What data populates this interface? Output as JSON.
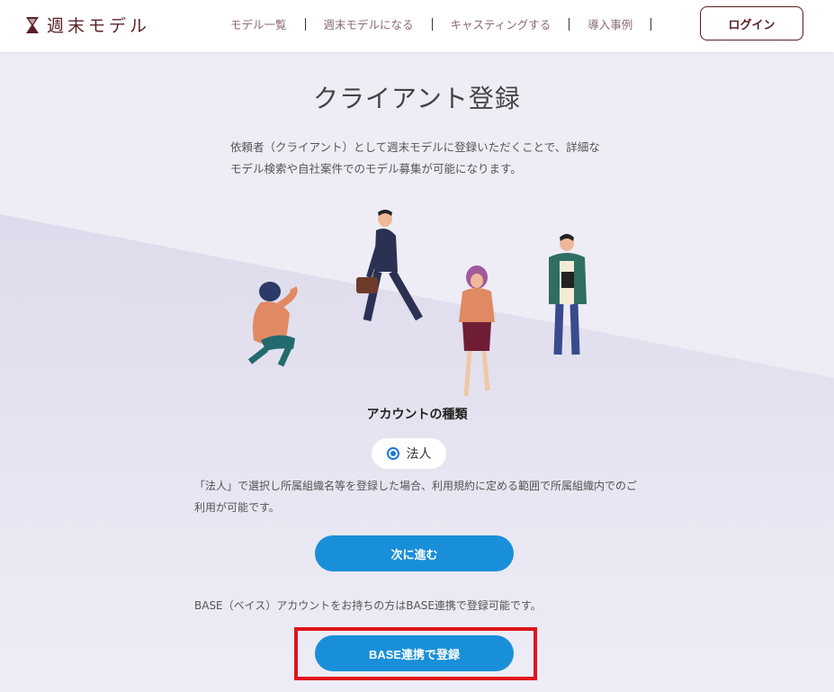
{
  "header": {
    "logo_text": "週末モデル",
    "nav": [
      "モデル一覧",
      "週末モデルになる",
      "キャスティングする",
      "導入事例"
    ],
    "login_label": "ログイン"
  },
  "main": {
    "title": "クライアント登録",
    "intro": "依頼者（クライアント）として週末モデルに登録いただくことで、詳細なモデル検索や自社案件でのモデル募集が可能になります。",
    "account_type_label": "アカウントの種類",
    "account_type_option": "法人",
    "corporate_note": "「法人」で選択し所属組織名等を登録した場合、利用規約に定める範囲で所属組織内でのご利用が可能です。",
    "next_button": "次に進む",
    "base_note": "BASE（ベイス）アカウントをお持ちの方はBASE連携で登録可能です。",
    "base_button": "BASE連携で登録"
  },
  "colors": {
    "brand": "#5a1f24",
    "primary_button": "#1a8fd9",
    "highlight_frame": "#e0141c",
    "radio": "#1e78d7"
  }
}
